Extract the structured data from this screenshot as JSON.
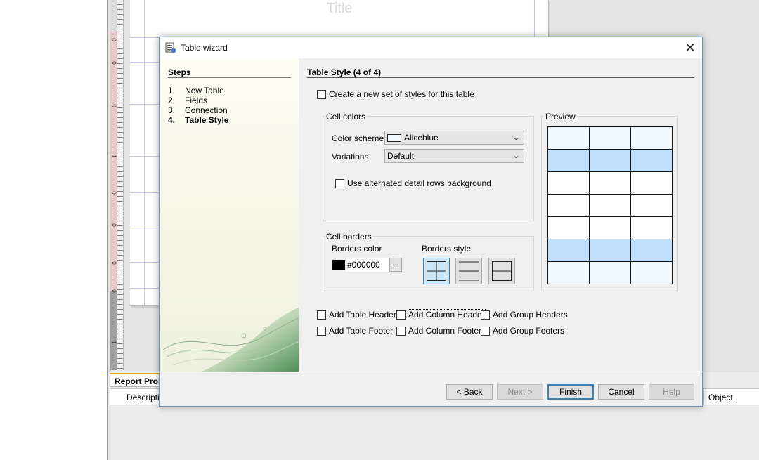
{
  "background": {
    "page_title": "Title",
    "ruler_numbers": [
      "0",
      "0",
      "0",
      "1",
      "0",
      "0",
      "0",
      "0",
      "1"
    ],
    "bottom_panel": {
      "tab_label": "Report Prol",
      "columns": [
        "Descriptio",
        "Object"
      ]
    }
  },
  "dialog": {
    "title": "Table wizard",
    "steps": {
      "heading": "Steps",
      "items": [
        {
          "num": "1.",
          "label": "New Table"
        },
        {
          "num": "2.",
          "label": "Fields"
        },
        {
          "num": "3.",
          "label": "Connection"
        },
        {
          "num": "4.",
          "label": "Table Style"
        }
      ],
      "active_index": 3
    },
    "section_title": "Table Style (4 of 4)",
    "create_styles": {
      "label": "Create a new set of styles for this table",
      "checked": false
    },
    "cell_colors": {
      "legend": "Cell colors",
      "color_scheme_label": "Color scheme",
      "color_scheme_value": "Aliceblue",
      "color_scheme_swatch": "#f0f8ff",
      "variations_label": "Variations",
      "variations_value": "Default",
      "alternated_rows": {
        "label": "Use alternated detail rows background",
        "checked": false
      }
    },
    "cell_borders": {
      "legend": "Cell borders",
      "borders_color_label": "Borders color",
      "borders_color_value": "#000000",
      "ellipsis": "...",
      "borders_style_label": "Borders style",
      "styles": [
        "all-borders",
        "horizontal-only",
        "outer-horizontal"
      ],
      "selected_style": 0
    },
    "preview": {
      "legend": "Preview",
      "row_colors": [
        "#f0f8ff",
        "#bfdffc",
        "#ffffff",
        "#ffffff",
        "#ffffff",
        "#bfdffc",
        "#f0f8ff"
      ],
      "columns": 3
    },
    "options": [
      {
        "label": "Add Table Header",
        "checked": false
      },
      {
        "label": "Add Column Header",
        "checked": false
      },
      {
        "label": "Add Group Headers",
        "checked": false
      },
      {
        "label": "Add Table Footer",
        "checked": false
      },
      {
        "label": "Add Column Footer",
        "checked": false
      },
      {
        "label": "Add Group Footers",
        "checked": false
      }
    ],
    "buttons": {
      "back": "< Back",
      "next": "Next >",
      "finish": "Finish",
      "cancel": "Cancel",
      "help": "Help"
    }
  }
}
